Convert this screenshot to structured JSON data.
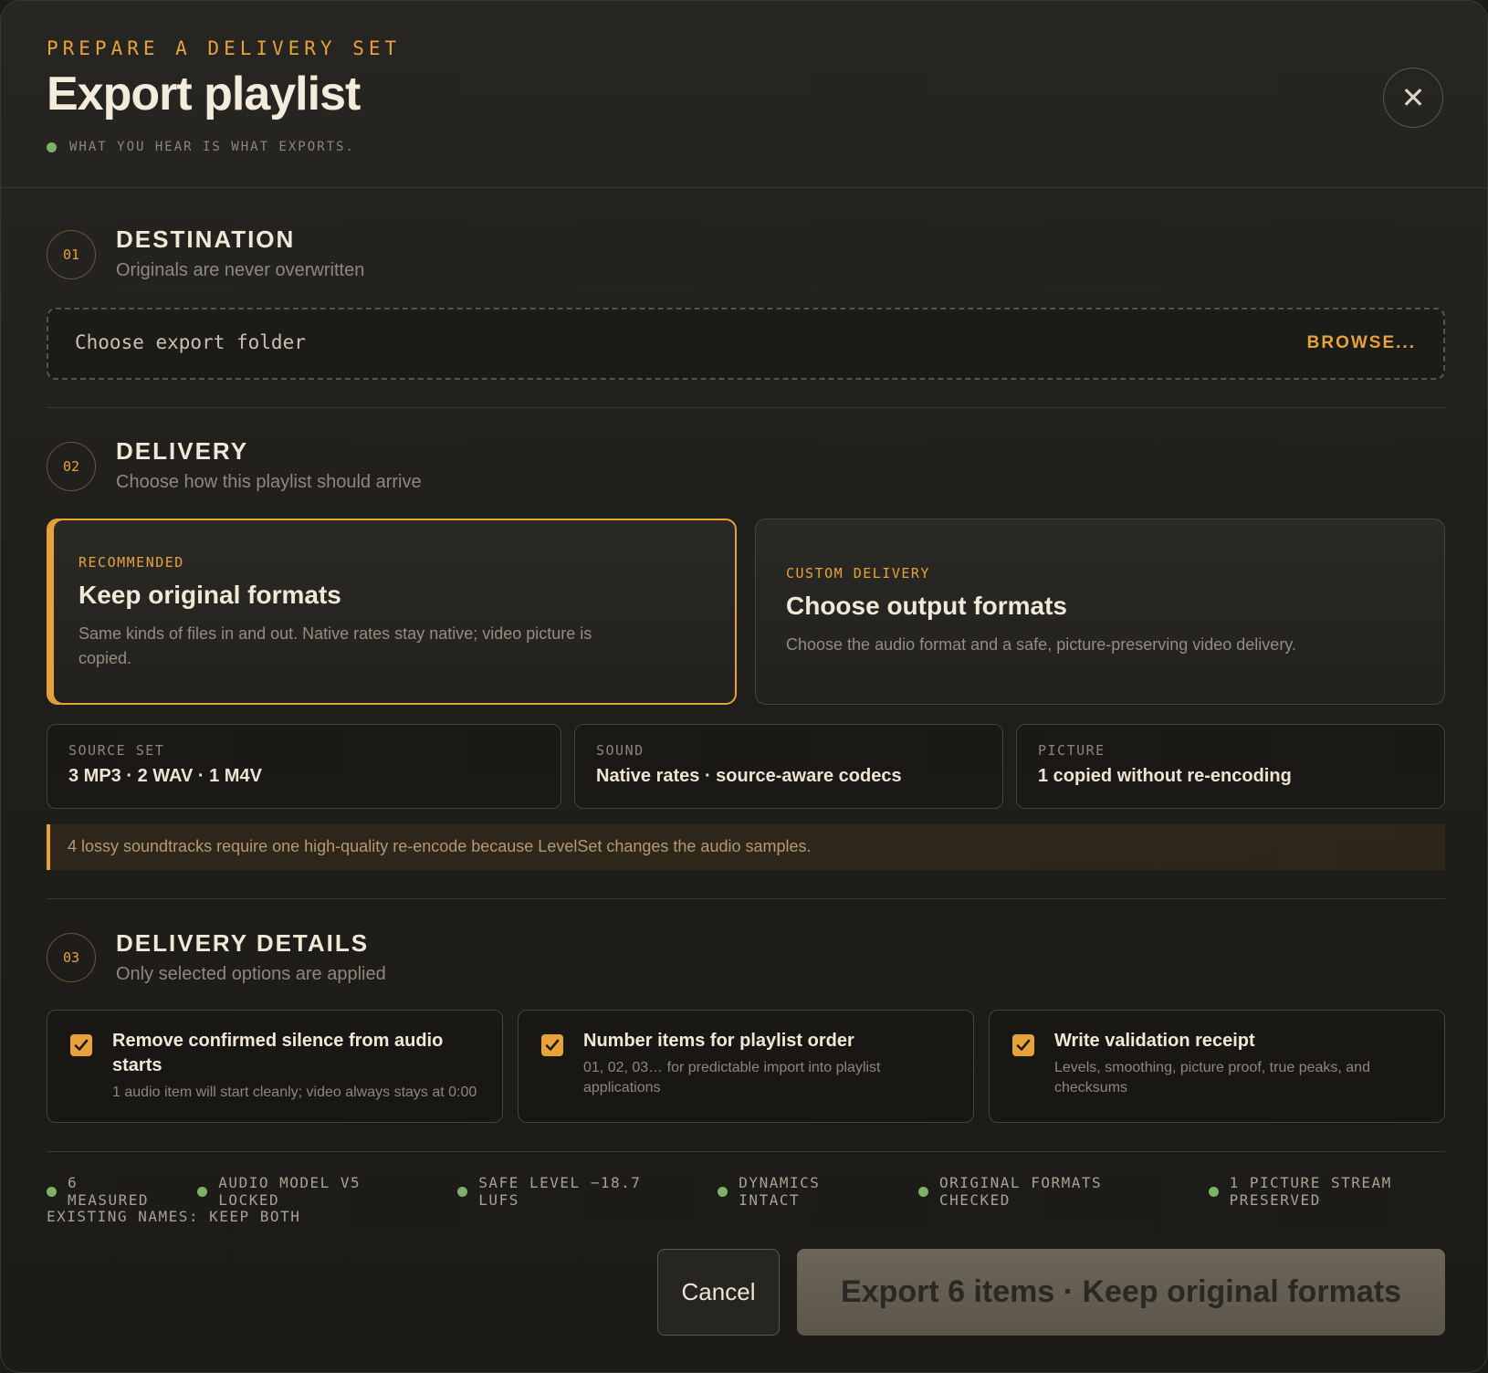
{
  "header": {
    "eyebrow": "PREPARE A DELIVERY SET",
    "title": "Export playlist",
    "tagline": "WHAT YOU HEAR IS WHAT EXPORTS.",
    "close_label": "✕"
  },
  "destination": {
    "step": "01",
    "title": "DESTINATION",
    "subtitle": "Originals are never overwritten",
    "placeholder": "Choose export folder",
    "browse_label": "BROWSE..."
  },
  "delivery": {
    "step": "02",
    "title": "DELIVERY",
    "subtitle": "Choose how this playlist should arrive",
    "options": [
      {
        "eyebrow": "RECOMMENDED",
        "title": "Keep original formats",
        "description": "Same kinds of files in and out. Native rates stay native; video picture is copied.",
        "selected": true
      },
      {
        "eyebrow": "CUSTOM DELIVERY",
        "title": "Choose output formats",
        "description": "Choose the audio format and a safe, picture-preserving video delivery.",
        "selected": false
      }
    ],
    "summary": [
      {
        "label": "SOURCE SET",
        "value": "3 MP3 · 2 WAV · 1 M4V"
      },
      {
        "label": "SOUND",
        "value": "Native rates · source-aware codecs"
      },
      {
        "label": "PICTURE",
        "value": "1 copied without re-encoding"
      }
    ],
    "notice": "4 lossy soundtracks require one high-quality re-encode because LevelSet changes the audio samples."
  },
  "details": {
    "step": "03",
    "title": "DELIVERY DETAILS",
    "subtitle": "Only selected options are applied",
    "options": [
      {
        "title": "Remove confirmed silence from audio starts",
        "description": "1 audio item will start cleanly; video always stays at 0:00",
        "checked": true
      },
      {
        "title": "Number items for playlist order",
        "description": "01, 02, 03… for predictable import into playlist applications",
        "checked": true
      },
      {
        "title": "Write validation receipt",
        "description": "Levels, smoothing, picture proof, true peaks, and checksums",
        "checked": true
      }
    ]
  },
  "status": [
    "6 MEASURED",
    "AUDIO MODEL V5 LOCKED",
    "SAFE LEVEL −18.7 LUFS",
    "DYNAMICS INTACT",
    "ORIGINAL FORMATS CHECKED",
    "1 PICTURE STREAM PRESERVED"
  ],
  "existing_names": "EXISTING NAMES: KEEP BOTH",
  "actions": {
    "cancel_label": "Cancel",
    "export_label": "Export 6 items · Keep original formats"
  },
  "colors": {
    "accent": "#e8a23a",
    "status_dot": "#7fb068",
    "background": "#1c1b18"
  }
}
